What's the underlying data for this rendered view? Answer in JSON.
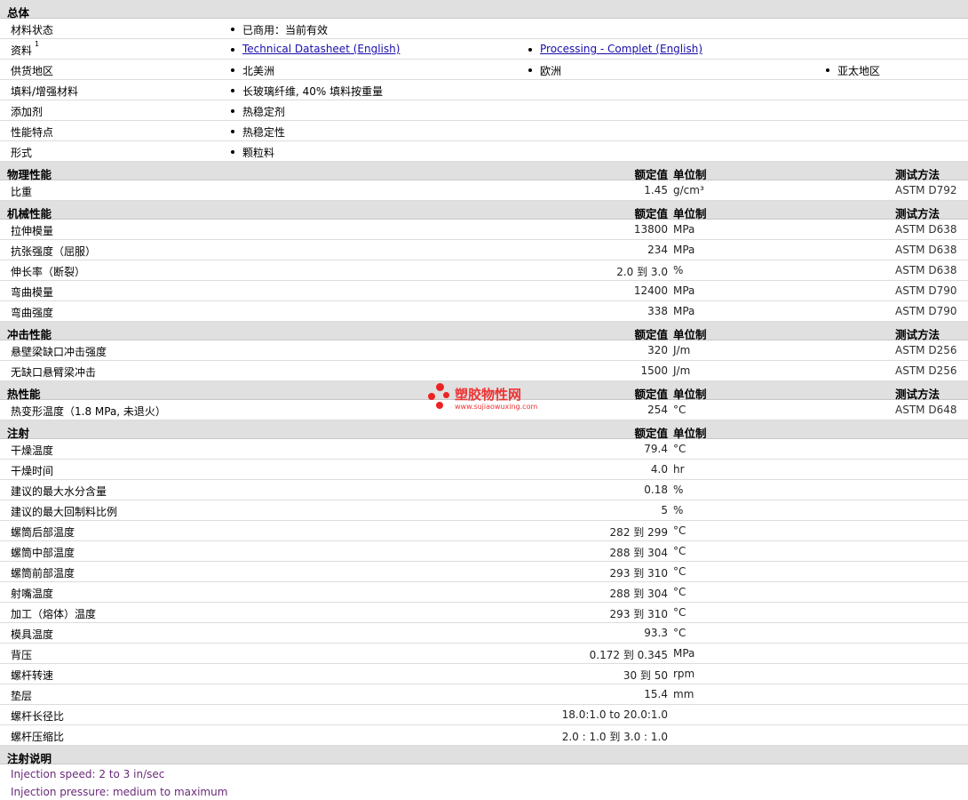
{
  "sections": [
    {
      "title": "总体",
      "header": false,
      "rows": [
        {
          "label": "材料状态",
          "items": [
            "已商用：当前有效"
          ]
        },
        {
          "label": "资料",
          "sup": "1",
          "items": [
            "Technical Datasheet (English)",
            "Processing - Complet (English)"
          ],
          "links": true
        },
        {
          "label": "供货地区",
          "items": [
            "北美洲",
            "欧洲",
            "亚太地区"
          ]
        },
        {
          "label": "填料/增强材料",
          "items": [
            "长玻璃纤维, 40% 填料按重量"
          ]
        },
        {
          "label": "添加剂",
          "items": [
            "热稳定剂"
          ]
        },
        {
          "label": "性能特点",
          "items": [
            "热稳定性"
          ]
        },
        {
          "label": "形式",
          "items": [
            "颗粒料"
          ]
        }
      ]
    },
    {
      "title": "物理性能",
      "header": true,
      "col_value": "额定值",
      "col_unit": "单位制",
      "col_method": "测试方法",
      "rows": [
        {
          "label": "比重",
          "value": "1.45",
          "unit": "g/cm³",
          "method": "ASTM D792"
        }
      ]
    },
    {
      "title": "机械性能",
      "header": true,
      "col_value": "额定值",
      "col_unit": "单位制",
      "col_method": "测试方法",
      "rows": [
        {
          "label": "拉伸模量",
          "value": "13800",
          "unit": "MPa",
          "method": "ASTM D638"
        },
        {
          "label": "抗张强度（屈服）",
          "value": "234",
          "unit": "MPa",
          "method": "ASTM D638"
        },
        {
          "label": "伸长率（断裂）",
          "value": "2.0 到 3.0",
          "unit": "%",
          "method": "ASTM D638"
        },
        {
          "label": "弯曲模量",
          "value": "12400",
          "unit": "MPa",
          "method": "ASTM D790"
        },
        {
          "label": "弯曲强度",
          "value": "338",
          "unit": "MPa",
          "method": "ASTM D790"
        }
      ]
    },
    {
      "title": "冲击性能",
      "header": true,
      "col_value": "额定值",
      "col_unit": "单位制",
      "col_method": "测试方法",
      "rows": [
        {
          "label": "悬壁梁缺口冲击强度",
          "value": "320",
          "unit": "J/m",
          "method": "ASTM D256"
        },
        {
          "label": "无缺口悬臂梁冲击",
          "value": "1500",
          "unit": "J/m",
          "method": "ASTM D256"
        }
      ]
    },
    {
      "title": "热性能",
      "header": true,
      "col_value": "额定值",
      "col_unit": "单位制",
      "col_method": "测试方法",
      "rows": [
        {
          "label": "热变形温度（1.8 MPa, 未退火）",
          "value": "254",
          "unit": "°C",
          "method": "ASTM D648"
        }
      ]
    },
    {
      "title": "注射",
      "header": true,
      "col_value": "额定值",
      "col_unit": "单位制",
      "col_method": "",
      "rows": [
        {
          "label": "干燥温度",
          "value": "79.4",
          "unit": "°C",
          "method": ""
        },
        {
          "label": "干燥时间",
          "value": "4.0",
          "unit": "hr",
          "method": ""
        },
        {
          "label": "建议的最大水分含量",
          "value": "0.18",
          "unit": "%",
          "method": ""
        },
        {
          "label": "建议的最大回制料比例",
          "value": "5",
          "unit": "%",
          "method": ""
        },
        {
          "label": "螺筒后部温度",
          "value": "282 到 299",
          "unit": "°C",
          "method": ""
        },
        {
          "label": "螺筒中部温度",
          "value": "288 到 304",
          "unit": "°C",
          "method": ""
        },
        {
          "label": "螺筒前部温度",
          "value": "293 到 310",
          "unit": "°C",
          "method": ""
        },
        {
          "label": "射嘴温度",
          "value": "288 到 304",
          "unit": "°C",
          "method": ""
        },
        {
          "label": "加工（熔体）温度",
          "value": "293 到 310",
          "unit": "°C",
          "method": ""
        },
        {
          "label": "模具温度",
          "value": "93.3",
          "unit": "°C",
          "method": ""
        },
        {
          "label": "背压",
          "value": "0.172 到 0.345",
          "unit": "MPa",
          "method": ""
        },
        {
          "label": "螺杆转速",
          "value": "30 到 50",
          "unit": "rpm",
          "method": ""
        },
        {
          "label": "垫层",
          "value": "15.4",
          "unit": "mm",
          "method": ""
        },
        {
          "label": "螺杆长径比",
          "value": "18.0:1.0 to 20.0:1.0",
          "unit": "",
          "method": ""
        },
        {
          "label": "螺杆压缩比",
          "value": "2.0 : 1.0 到 3.0 : 1.0",
          "unit": "",
          "method": ""
        }
      ]
    }
  ],
  "notes": {
    "title": "注射说明",
    "lines": [
      "Injection speed: 2 to 3 in/sec",
      "Injection pressure: medium to maximum"
    ]
  },
  "watermark": {
    "name": "塑胶物性网",
    "url": "www.sujiaowuxing.com"
  }
}
